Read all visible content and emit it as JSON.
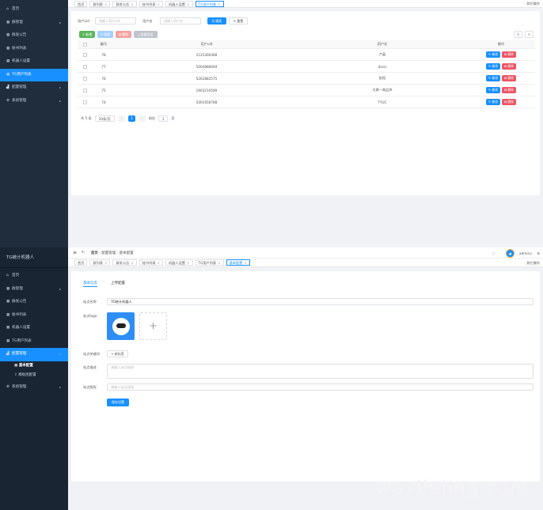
{
  "sidebar_top": {
    "items": [
      {
        "icon": "home-icon",
        "glyph": "⌂",
        "label": "首页",
        "arrow": false,
        "active": false
      },
      {
        "icon": "grid-icon",
        "glyph": "▦",
        "label": "群管理",
        "arrow": true,
        "active": false
      },
      {
        "icon": "grid-icon",
        "glyph": "▦",
        "label": "群发公告",
        "arrow": false,
        "active": false
      },
      {
        "icon": "grid-icon",
        "glyph": "▦",
        "label": "秘书列表",
        "arrow": false,
        "active": false
      },
      {
        "icon": "grid-icon",
        "glyph": "▦",
        "label": "机器人设置",
        "arrow": false,
        "active": false
      },
      {
        "icon": "grid-icon",
        "glyph": "▦",
        "label": "TG用户列表",
        "arrow": false,
        "active": true
      },
      {
        "icon": "chart-icon",
        "glyph": "▟",
        "label": "配置管理",
        "arrow": true,
        "active": false
      },
      {
        "icon": "gear-icon",
        "glyph": "⚙",
        "label": "系统管理",
        "arrow": true,
        "active": false
      }
    ]
  },
  "tabs_top": {
    "items": [
      "首页",
      "群列表",
      "群发公告",
      "秘书列表",
      "机器人设置",
      "TG用户列表"
    ],
    "current": 5,
    "right": "其它操作"
  },
  "search": {
    "uid_label": "用户uid",
    "uid_placeholder": "请输入用户uid",
    "name_label": "用户名",
    "name_placeholder": "请输入用户名",
    "search_btn": "Q 搜索",
    "reset_btn": "↻ 重置"
  },
  "toolbar": {
    "add": "+ 新增",
    "edit": "✎ 修改",
    "delete": "⊠ 删除",
    "export": "⤓ 批量导出",
    "search_toggle": "Q",
    "refresh": "↻"
  },
  "table": {
    "headers": {
      "id": "编号",
      "uid": "用户uid",
      "name": "用户名",
      "op": "操作"
    },
    "rows": [
      {
        "id": "78",
        "uid": "2125300488",
        "name": "卢晶"
      },
      {
        "id": "77",
        "uid": "5004888949",
        "name": "dosis"
      },
      {
        "id": "76",
        "uid": "5262882575",
        "name": "阳阳"
      },
      {
        "id": "75",
        "uid": "1903210599",
        "name": "光哥—商品库"
      },
      {
        "id": "74",
        "uid": "5001658788",
        "name": "TYUC"
      }
    ],
    "edit_label": "✎ 修改",
    "delete_label": "⊠ 删除"
  },
  "pagination": {
    "total": "共 5 条",
    "page_size": "20条/页",
    "prev": "‹",
    "current": "1",
    "next": "›",
    "goto_label": "前往",
    "goto_value": "1",
    "page_unit": "页"
  },
  "sidebar_bottom": {
    "title": "TG统计机器人",
    "items": [
      {
        "icon": "home-icon",
        "glyph": "⌂",
        "label": "首页",
        "arrow": false
      },
      {
        "icon": "grid-icon",
        "glyph": "▦",
        "label": "群管理",
        "arrow": true
      },
      {
        "icon": "grid-icon",
        "glyph": "▦",
        "label": "群发公告",
        "arrow": false
      },
      {
        "icon": "grid-icon",
        "glyph": "▦",
        "label": "秘书列表",
        "arrow": false
      },
      {
        "icon": "grid-icon",
        "glyph": "▦",
        "label": "机器人设置",
        "arrow": false
      },
      {
        "icon": "grid-icon",
        "glyph": "▦",
        "label": "TG用户列表",
        "arrow": false
      }
    ],
    "open_item": {
      "icon": "chart-icon",
      "glyph": "▟",
      "label": "配置管理",
      "arrow": "▾"
    },
    "sub_items": [
      {
        "icon": "grid-icon",
        "glyph": "▦",
        "label": "基本配置",
        "current": true
      },
      {
        "icon": "upload-icon",
        "glyph": "⇪",
        "label": "模板图配置",
        "current": false
      }
    ],
    "last_item": {
      "icon": "gear-icon",
      "glyph": "⚙",
      "label": "系统管理",
      "arrow": true
    }
  },
  "navbar": {
    "menu_icon": "≡",
    "refresh_icon": "↻",
    "breadcrumb": [
      "首页",
      "配置管理",
      "基本配置"
    ],
    "separator": "/",
    "fullscreen_icon": "⛶",
    "user": "admin",
    "user_arrow": "∨",
    "settings_icon": "⚙"
  },
  "tabs_bottom": {
    "items": [
      "首页",
      "群列表",
      "群发公告",
      "秘书列表",
      "机器人设置",
      "TG用户列表",
      "基本配置"
    ],
    "current": 6,
    "right": "其它操作"
  },
  "form": {
    "tabs": [
      "基本信息",
      "上传配置"
    ],
    "bot_name_label": "站点名称",
    "bot_name_value": "TG统计机器人",
    "logo_label": "站点logo",
    "upload_plus": "+",
    "keywords_label": "站点关键词",
    "keywords_btn": "+ 新标签",
    "desc_label": "站点描述",
    "desc_placeholder": "请输入站点描述",
    "copyright_label": "站点版权",
    "copyright_placeholder": "请输入站点版权",
    "save_btn": "保存设置"
  },
  "watermark": "waxilejing.com"
}
